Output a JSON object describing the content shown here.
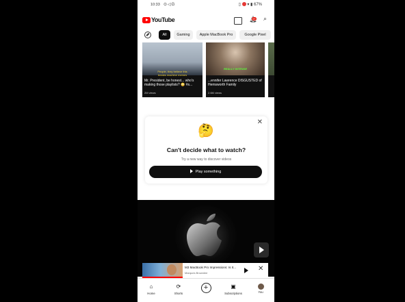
{
  "status_bar": {
    "time": "10:33",
    "battery": "67%"
  },
  "header": {
    "logo_text": "YouTube",
    "notification_count": "9+"
  },
  "chips": [
    {
      "label": "All",
      "active": true
    },
    {
      "label": "Gaming",
      "active": false
    },
    {
      "label": "Apple MacBook Pro",
      "active": false
    },
    {
      "label": "Google Pixel",
      "active": false
    }
  ],
  "shorts": [
    {
      "overlay": "People, they believe this breaks machine memes",
      "title": "Mr. President, be honest... who's making those playlists? 😳 #s...",
      "views": "2M views"
    },
    {
      "overlay": "REALLY INTENSE",
      "title": "...ennifer Lawrence DISGUSTED of Hemsworth Family",
      "views": "2.6M views"
    }
  ],
  "prompt": {
    "emoji": "🤔",
    "heading": "Can't decide what to watch?",
    "subtext": "Try a new way to discover videos",
    "button": "Play something"
  },
  "mini_player": {
    "title": "M3 MacBook Pro Impressions: Is It...",
    "channel": "Marques Brownlee"
  },
  "bottom_nav": [
    {
      "label": "Home",
      "icon": "home-icon"
    },
    {
      "label": "Shorts",
      "icon": "shorts-icon"
    },
    {
      "label": "",
      "icon": "create-icon"
    },
    {
      "label": "Subscriptions",
      "icon": "subscriptions-icon"
    },
    {
      "label": "You",
      "icon": "you-avatar"
    }
  ]
}
